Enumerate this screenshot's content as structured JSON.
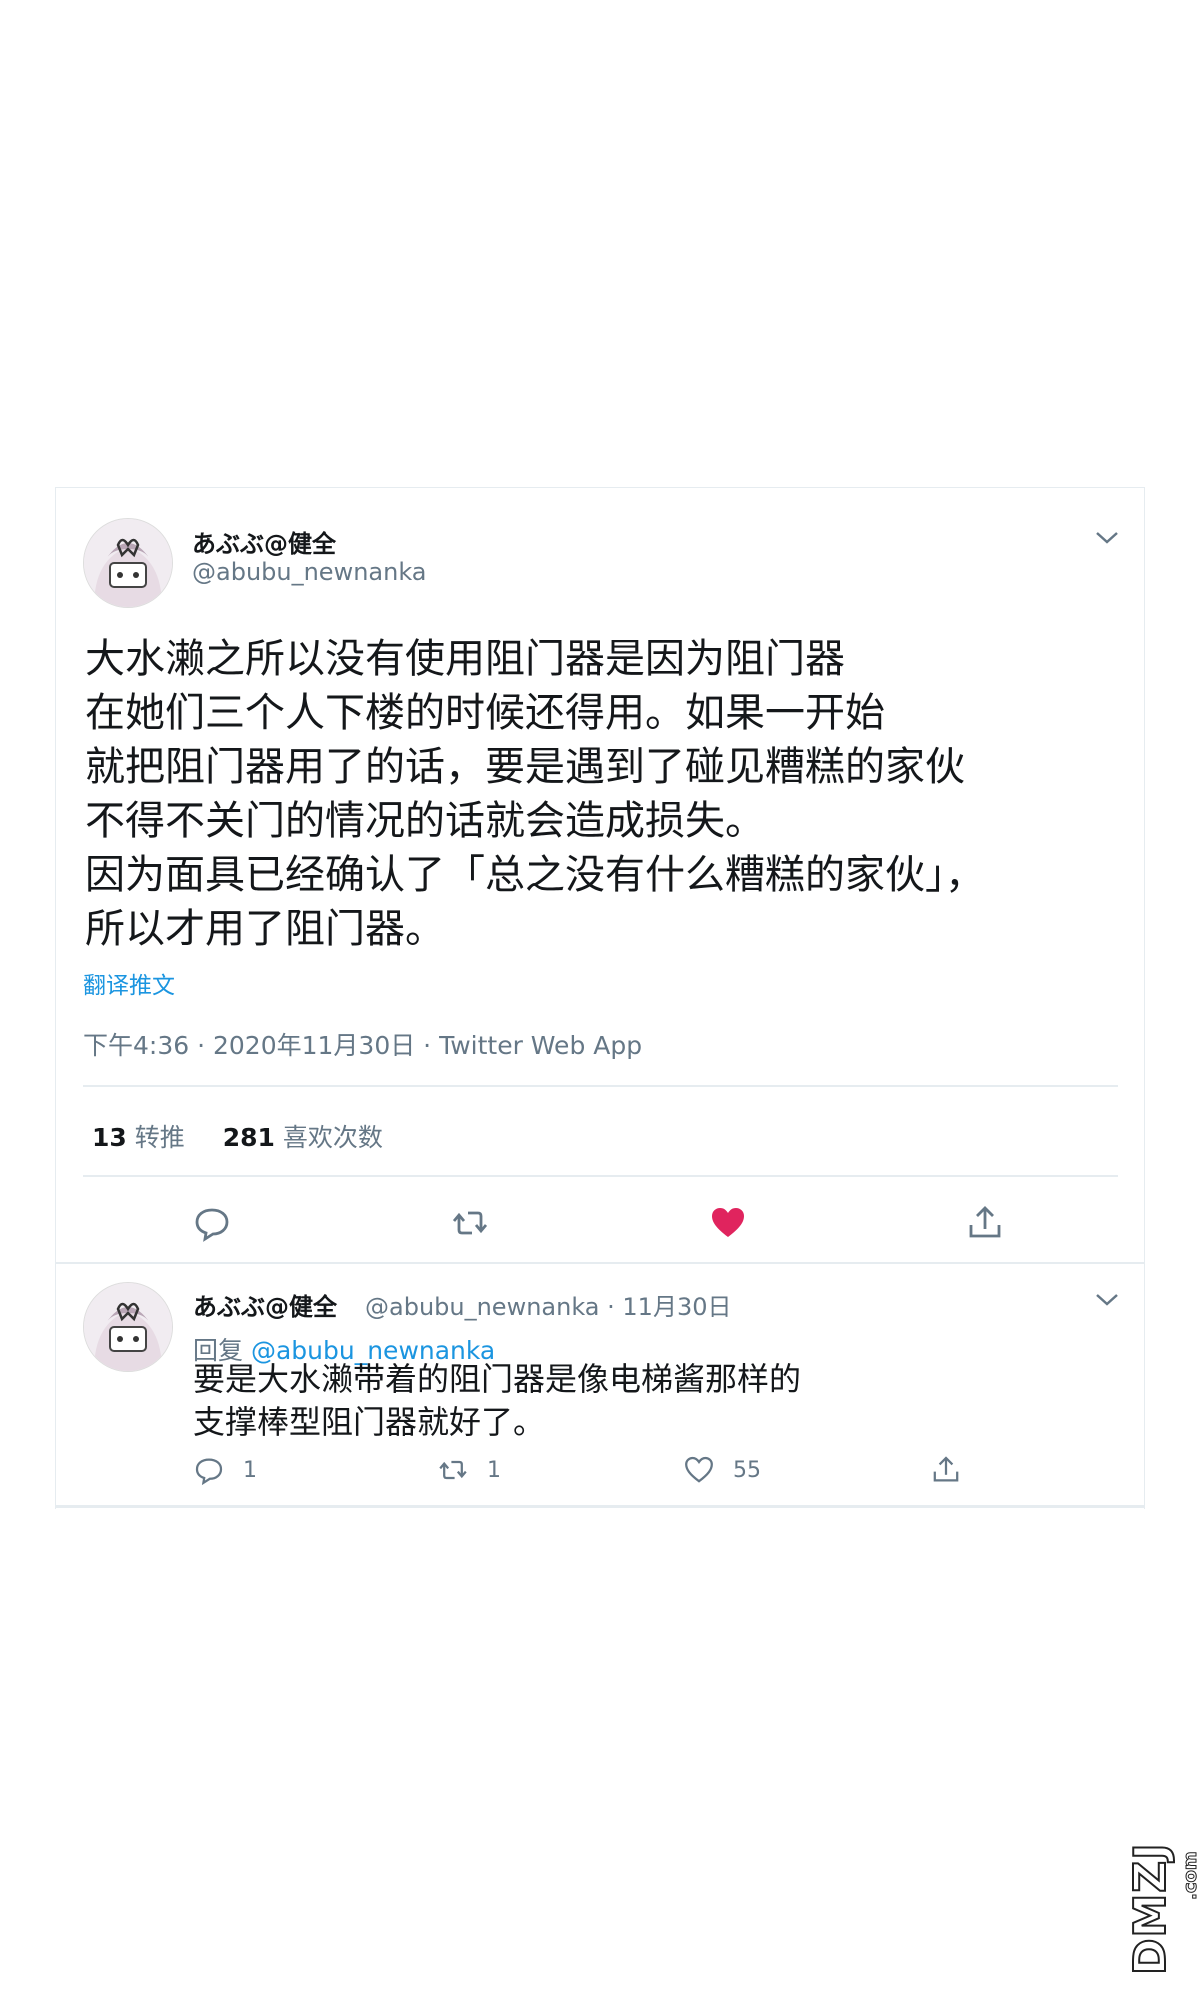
{
  "main_tweet": {
    "display_name": "あぶぶ@健全",
    "handle": "@abubu_newnanka",
    "text": "大水濑之所以没有使用阻门器是因为阻门器\n在她们三个人下楼的时候还得用。如果一开始\n就把阻门器用了的话，要是遇到了碰见糟糕的家伙\n不得不关门的情况的话就会造成损失。\n因为面具已经确认了「总之没有什么糟糕的家伙」，\n所以才用了阻门器。",
    "translate_label": "翻译推文",
    "timestamp": "下午4:36 · 2020年11月30日 · Twitter Web App",
    "retweet_count": "13",
    "retweet_label": "转推",
    "like_count": "281",
    "like_label": "喜欢次数",
    "liked_color": "#e0245e"
  },
  "reply_tweet": {
    "display_name": "あぶぶ@健全",
    "handle_date": "@abubu_newnanka · 11月30日",
    "reply_prefix": "回复",
    "reply_mention": "@abubu_newnanka",
    "text": "要是大水濑带着的阻门器是像电梯酱那样的\n支撑棒型阻门器就好了。",
    "reply_count": "1",
    "retweet_count": "1",
    "like_count": "55"
  },
  "icons": [
    "chevron-down-icon",
    "reply-icon",
    "retweet-icon",
    "heart-icon",
    "share-icon"
  ],
  "watermark": {
    "text": "DMZJ",
    "suffix": ".com"
  },
  "colors": {
    "link": "#1b95e0",
    "secondary_text": "#657786",
    "divider": "#e6ecf0"
  }
}
